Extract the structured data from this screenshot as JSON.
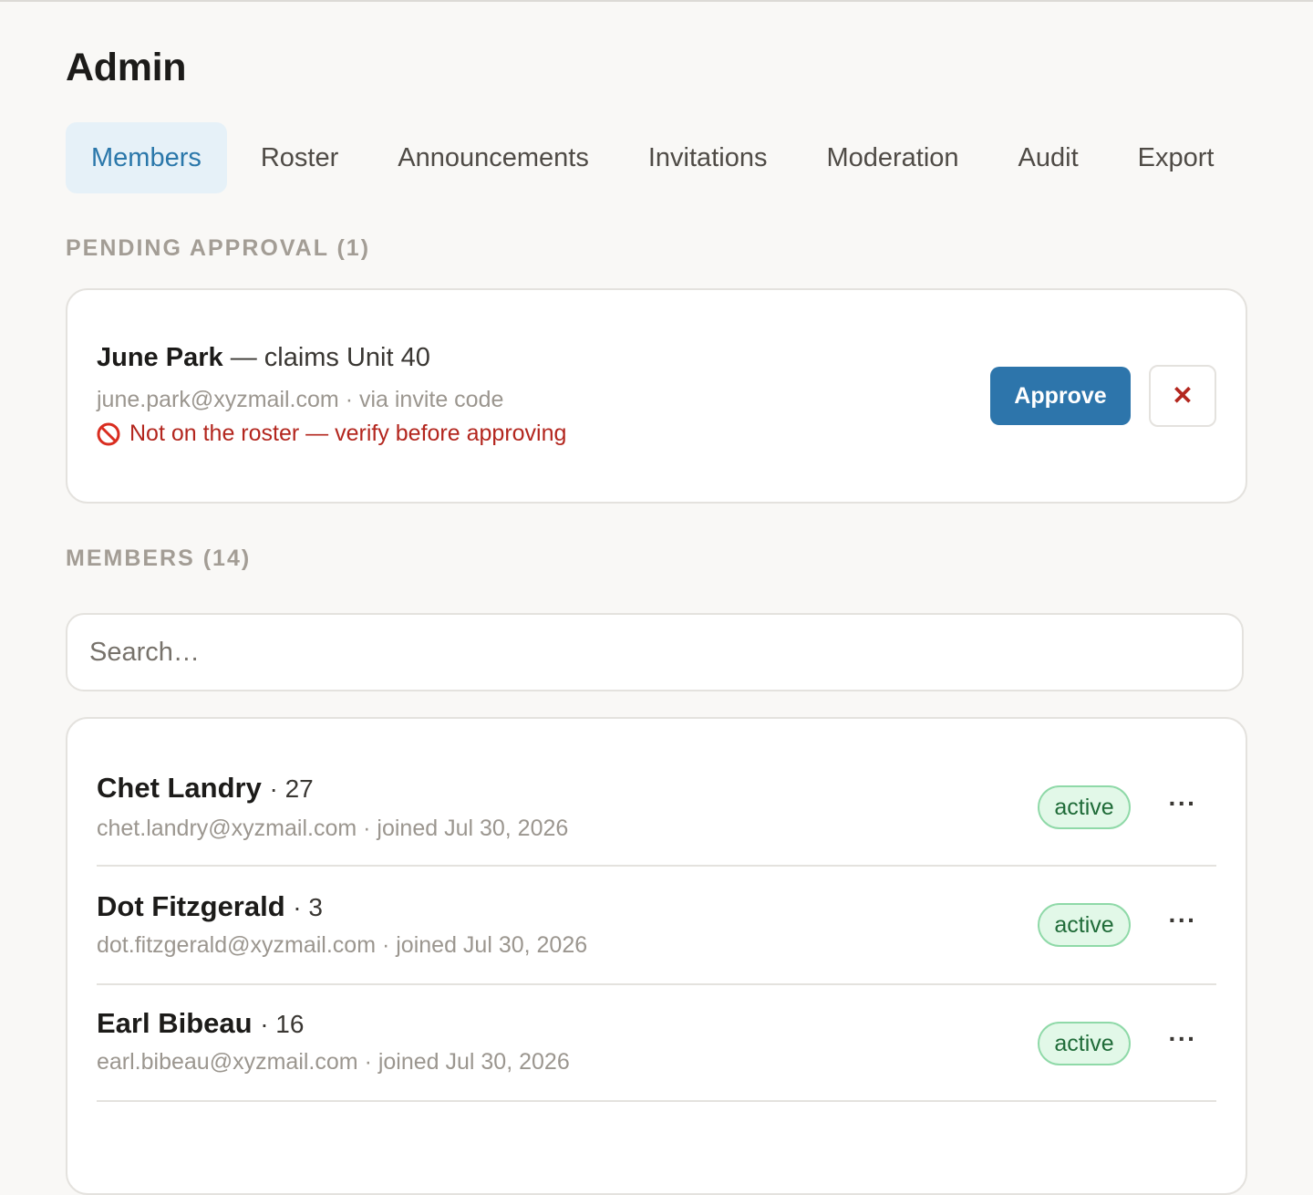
{
  "page_title": "Admin",
  "tabs": [
    {
      "label": "Members",
      "active": true
    },
    {
      "label": "Roster",
      "active": false
    },
    {
      "label": "Announcements",
      "active": false
    },
    {
      "label": "Invitations",
      "active": false
    },
    {
      "label": "Moderation",
      "active": false
    },
    {
      "label": "Audit",
      "active": false
    },
    {
      "label": "Export",
      "active": false
    }
  ],
  "pending": {
    "section_label": "PENDING APPROVAL (1)",
    "name": "June Park",
    "claim": "— claims Unit 40",
    "email": "june.park@xyzmail.com",
    "via": "· via invite code",
    "warning_icon": "no-entry-icon",
    "warning": "Not on the roster — verify before approving",
    "approve_label": "Approve",
    "reject_icon": "close-icon",
    "reject_label": "✕"
  },
  "members": {
    "section_label": "MEMBERS (14)",
    "search_placeholder": "Search…",
    "more_label": "···",
    "rows": [
      {
        "name": "Chet Landry",
        "unit": "· 27",
        "email": "chet.landry@xyzmail.com",
        "joined": "· joined Jul 30, 2026",
        "status": "active"
      },
      {
        "name": "Dot Fitzgerald",
        "unit": "· 3",
        "email": "dot.fitzgerald@xyzmail.com",
        "joined": "· joined Jul 30, 2026",
        "status": "active"
      },
      {
        "name": "Earl Bibeau",
        "unit": "· 16",
        "email": "earl.bibeau@xyzmail.com",
        "joined": "· joined Jul 30, 2026",
        "status": "active"
      }
    ]
  },
  "colors": {
    "accent": "#2d75ab",
    "active_tab_bg": "#e6f1f8",
    "warning": "#b3261e",
    "status_active_bg": "#e2f8e8",
    "status_active_text": "#1f6b38"
  }
}
